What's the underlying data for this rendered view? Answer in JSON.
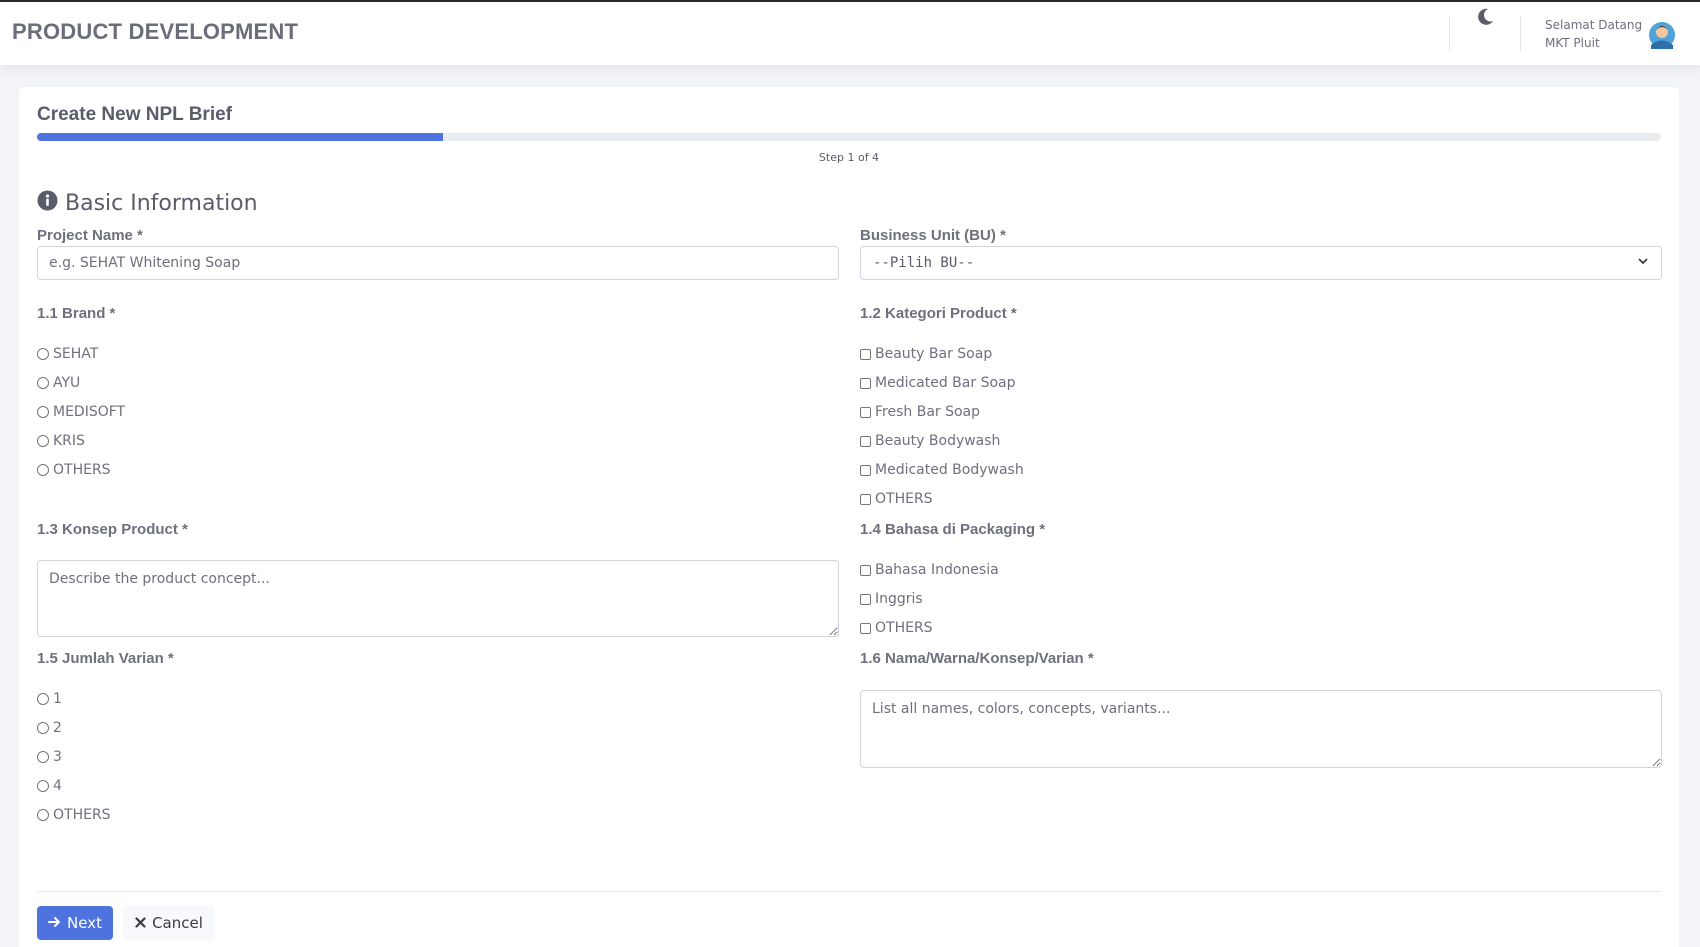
{
  "header": {
    "app_title": "PRODUCT DEVELOPMENT",
    "greeting": "Selamat Datang",
    "user_name": "MKT Pluit",
    "moon_icon": "moon-icon",
    "avatar_icon": "user-avatar-icon"
  },
  "form": {
    "title": "Create New NPL Brief",
    "progress_percent": 25,
    "step_text": "Step 1 of 4",
    "section_title": "Basic Information",
    "section_icon": "info-circle-icon",
    "project_name": {
      "label": "Project Name *",
      "placeholder": "e.g. SEHAT Whitening Soap",
      "value": ""
    },
    "business_unit": {
      "label": "Business Unit (BU) *",
      "selected": "--Pilih BU--"
    },
    "brand": {
      "label": "1.1 Brand *",
      "options": [
        "SEHAT",
        "AYU",
        "MEDISOFT",
        "KRIS",
        "OTHERS"
      ]
    },
    "kategori": {
      "label": "1.2 Kategori Product *",
      "options": [
        "Beauty Bar Soap",
        "Medicated Bar Soap",
        "Fresh Bar Soap",
        "Beauty Bodywash",
        "Medicated Bodywash",
        "OTHERS"
      ]
    },
    "konsep": {
      "label": "1.3 Konsep Product *",
      "placeholder": "Describe the product concept..."
    },
    "bahasa": {
      "label": "1.4 Bahasa di Packaging *",
      "options": [
        "Bahasa Indonesia",
        "Inggris",
        "OTHERS"
      ]
    },
    "jumlah_varian": {
      "label": "1.5 Jumlah Varian *",
      "options": [
        "1",
        "2",
        "3",
        "4",
        "OTHERS"
      ]
    },
    "nama_varian": {
      "label": "1.6 Nama/Warna/Konsep/Varian *",
      "placeholder": "List all names, colors, concepts, variants..."
    }
  },
  "actions": {
    "next_label": "Next",
    "cancel_label": "Cancel"
  },
  "colors": {
    "primary": "#4e73df",
    "text": "#5a5c69",
    "muted": "#6e707e",
    "background": "#f3f4f7"
  }
}
